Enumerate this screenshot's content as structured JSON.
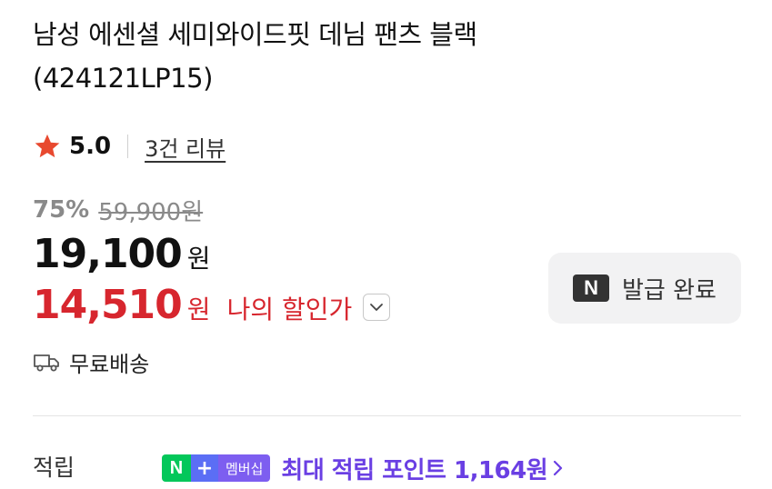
{
  "product": {
    "title": "남성 에센셜 세미와이드핏 데님 팬츠 블랙 (424121LP15)"
  },
  "rating": {
    "score": "5.0",
    "reviews_label": "3건 리뷰",
    "star_color": "#e8492f"
  },
  "pricing": {
    "discount_pct": "75%",
    "original_price": "59,900원",
    "sale_price": "19,100",
    "sale_unit": "원",
    "my_price": "14,510",
    "my_unit": "원",
    "my_price_label": "나의 할인가",
    "my_price_color": "#d7262e"
  },
  "coupon": {
    "badge": "N",
    "label": "발급 완료"
  },
  "shipping": {
    "label": "무료배송"
  },
  "points": {
    "label": "적립",
    "badge_n": "N",
    "badge_plus": "+",
    "badge_membership": "멤버십",
    "text": "최대 적립 포인트 1,164원",
    "color": "#6a3fe3"
  }
}
